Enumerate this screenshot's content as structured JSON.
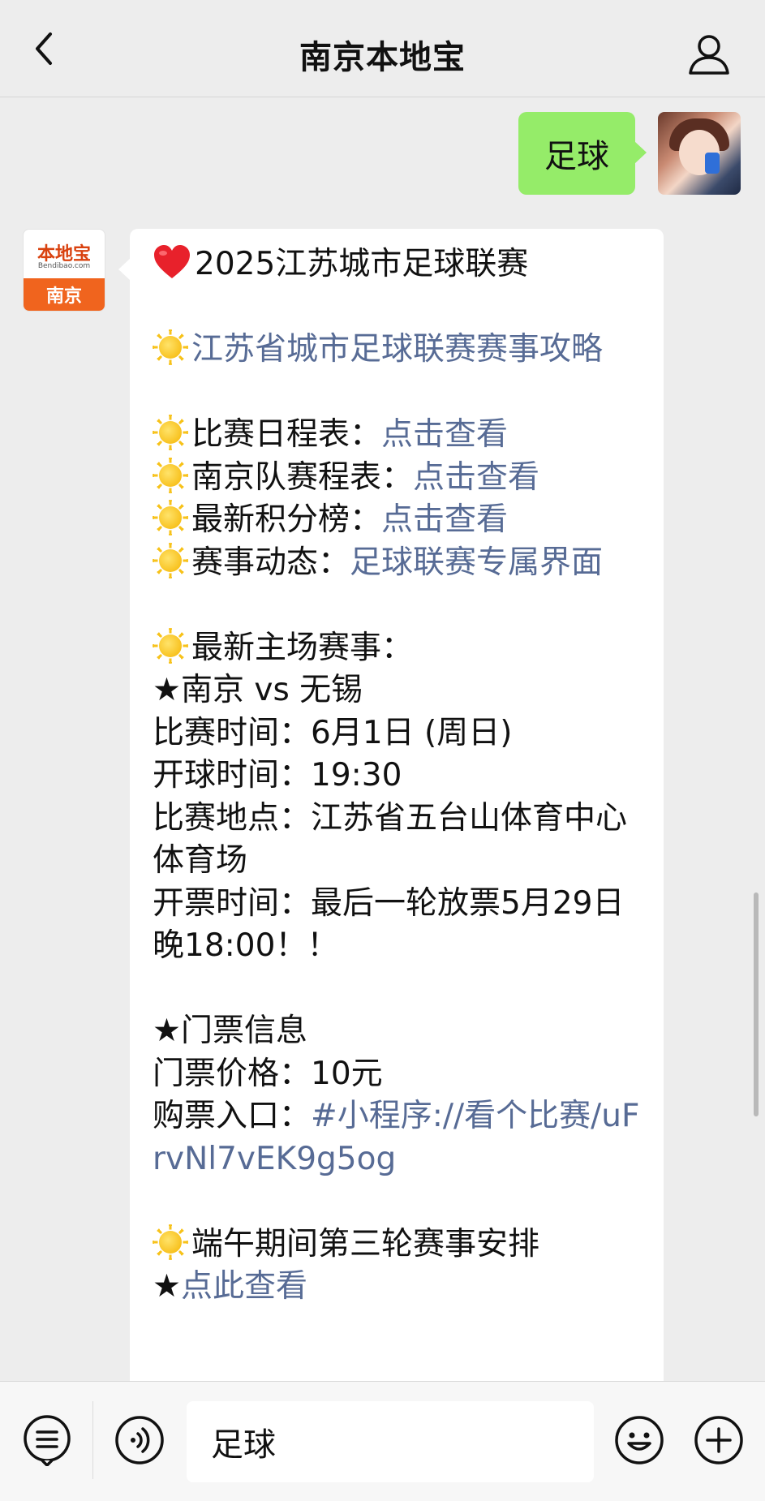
{
  "header": {
    "title": "南京本地宝",
    "back_icon": "chevron-left-icon",
    "profile_icon": "person-icon"
  },
  "outgoing_message": {
    "text": "足球"
  },
  "incoming_message": {
    "avatar": {
      "brand": "本地宝",
      "brand_sub": "Bendibao.com",
      "city": "南京"
    },
    "lines": [
      {
        "emoji": "heart",
        "text": "2025江苏城市足球联赛",
        "link": ""
      },
      {
        "emoji": "",
        "text": "",
        "link": ""
      },
      {
        "emoji": "sun",
        "text": "",
        "link": "江苏省城市足球联赛赛事攻略"
      },
      {
        "emoji": "",
        "text": "",
        "link": ""
      },
      {
        "emoji": "sun",
        "text": "比赛日程表：",
        "link": "点击查看"
      },
      {
        "emoji": "sun",
        "text": "南京队赛程表：",
        "link": "点击查看"
      },
      {
        "emoji": "sun",
        "text": "最新积分榜：",
        "link": "点击查看"
      },
      {
        "emoji": "sun",
        "text": "赛事动态：",
        "link": "足球联赛专属界面"
      },
      {
        "emoji": "",
        "text": "",
        "link": ""
      },
      {
        "emoji": "sun",
        "text": "最新主场赛事：",
        "link": ""
      },
      {
        "emoji": "",
        "text": "★南京 vs 无锡",
        "link": ""
      },
      {
        "emoji": "",
        "text": "比赛时间：6月1日 (周日)",
        "link": ""
      },
      {
        "emoji": "",
        "text": "开球时间：19:30",
        "link": ""
      },
      {
        "emoji": "",
        "text": "比赛地点：江苏省五台山体育中心体育场",
        "link": ""
      },
      {
        "emoji": "",
        "text": "开票时间：最后一轮放票5月29日晚18:00！！",
        "link": ""
      },
      {
        "emoji": "",
        "text": "",
        "link": ""
      },
      {
        "emoji": "",
        "text": "★门票信息",
        "link": ""
      },
      {
        "emoji": "",
        "text": "门票价格：10元",
        "link": ""
      },
      {
        "emoji": "",
        "text": "购票入口：",
        "link": "#小程序://看个比赛/uFrvNl7vEK9g5og"
      },
      {
        "emoji": "",
        "text": "",
        "link": ""
      },
      {
        "emoji": "sun",
        "text": "端午期间第三轮赛事安排",
        "link": ""
      },
      {
        "emoji": "",
        "text": "★",
        "link": "点此查看"
      }
    ]
  },
  "bottom_bar": {
    "input_value": "足球",
    "menu_icon": "menu-list-icon",
    "voice_icon": "voice-icon",
    "emoji_icon": "emoji-smile-icon",
    "plus_icon": "plus-icon"
  },
  "colors": {
    "link": "#576b95",
    "outgoing_bubble": "#95ec69",
    "brand_orange": "#f0641e"
  }
}
